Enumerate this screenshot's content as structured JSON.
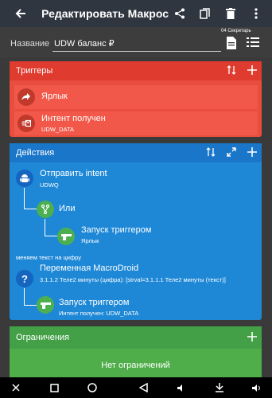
{
  "appbar": {
    "title": "Редактировать Макрос",
    "icons": [
      "back-arrow-icon",
      "share-icon",
      "copy-icon",
      "delete-icon",
      "more-icon"
    ]
  },
  "name_row": {
    "label": "Название",
    "value": "UDW баланс ₽",
    "category": "04 Секретарь"
  },
  "triggers": {
    "title": "Триггеры",
    "items": [
      {
        "label": "Ярлык",
        "sub": "",
        "icon": "shortcut-arrow-icon"
      },
      {
        "label": "Интент получен",
        "sub": "UDW_DATA",
        "icon": "intent-received-icon"
      }
    ]
  },
  "actions": {
    "title": "Действия",
    "items": [
      {
        "label": "Отправить intent",
        "sub": "UDWQ",
        "icon": "android-icon"
      },
      {
        "label": "Или",
        "sub": "",
        "icon": "branch-icon"
      },
      {
        "label": "Запуск триггером",
        "sub": "Ярлык",
        "icon": "gun-icon"
      },
      {
        "label": "Переменная MacroDroid",
        "sub": "3.1.1.2 Теле2 минуты (цифра): [strval=3.1.1.1 Теле2 минуты (текст)]",
        "icon": "question-icon"
      },
      {
        "label": "Запуск триггером",
        "sub": "Интент получен: UDW_DATA",
        "icon": "gun-icon"
      }
    ],
    "comment": "меняем текст на цифру"
  },
  "constraints": {
    "title": "Ограничения",
    "empty_label": "Нет ограничений"
  },
  "colors": {
    "appbar": "#2f3640",
    "triggers": "#e84d3d",
    "actions": "#1e88d6",
    "constraints": "#4fae4a"
  }
}
